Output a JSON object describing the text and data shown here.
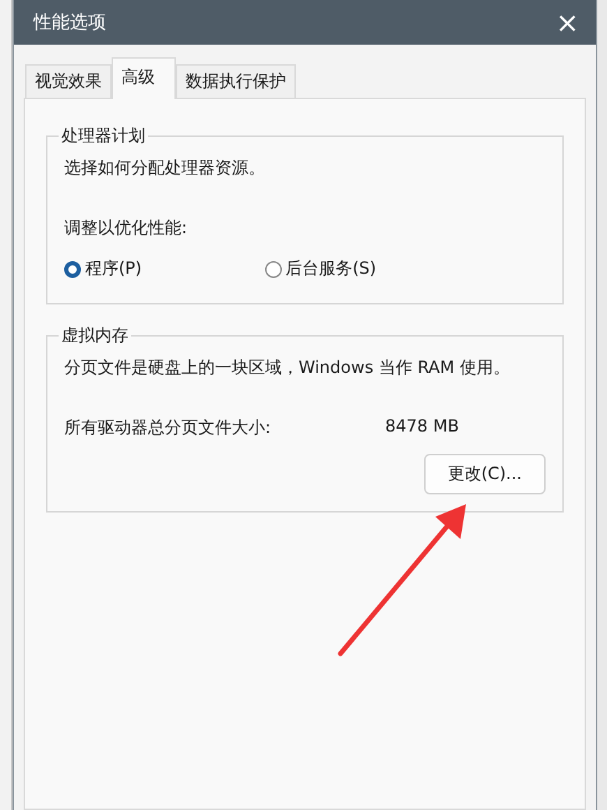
{
  "window": {
    "title": "性能选项",
    "close": "×"
  },
  "tabs": [
    {
      "label": "视觉效果",
      "selected": false
    },
    {
      "label": "高级",
      "selected": true
    },
    {
      "label": "数据执行保护",
      "selected": false
    }
  ],
  "processor": {
    "title": "处理器计划",
    "description": "选择如何分配处理器资源。",
    "prompt": "调整以优化性能:",
    "options": [
      {
        "label": "程序(P)",
        "selected": true
      },
      {
        "label": "后台服务(S)",
        "selected": false
      }
    ]
  },
  "virtual_memory": {
    "title": "虚拟内存",
    "description": "分页文件是硬盘上的一块区域，Windows 当作 RAM 使用。",
    "size_label": "所有驱动器总分页文件大小:",
    "size_value": "8478 MB",
    "button": "更改(C)..."
  }
}
